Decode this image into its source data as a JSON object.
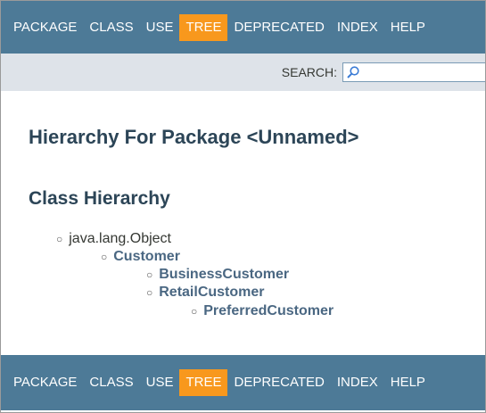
{
  "nav_top": {
    "items": [
      {
        "label": "PACKAGE",
        "active": false
      },
      {
        "label": "CLASS",
        "active": false
      },
      {
        "label": "USE",
        "active": false
      },
      {
        "label": "TREE",
        "active": true
      },
      {
        "label": "DEPRECATED",
        "active": false
      },
      {
        "label": "INDEX",
        "active": false
      },
      {
        "label": "HELP",
        "active": false
      }
    ]
  },
  "search": {
    "label": "SEARCH:",
    "value": "",
    "icon": "search-icon"
  },
  "page": {
    "title": "Hierarchy For Package <Unnamed>",
    "section_title": "Class Hierarchy"
  },
  "tree": [
    {
      "label": "java.lang.Object",
      "link": false
    },
    {
      "label": "Customer",
      "link": true
    },
    {
      "label": "BusinessCustomer",
      "link": true
    },
    {
      "label": "RetailCustomer",
      "link": true
    },
    {
      "label": "PreferredCustomer",
      "link": true
    }
  ],
  "nav_bottom": {
    "items": [
      {
        "label": "PACKAGE",
        "active": false
      },
      {
        "label": "CLASS",
        "active": false
      },
      {
        "label": "USE",
        "active": false
      },
      {
        "label": "TREE",
        "active": true
      },
      {
        "label": "DEPRECATED",
        "active": false
      },
      {
        "label": "INDEX",
        "active": false
      },
      {
        "label": "HELP",
        "active": false
      }
    ]
  },
  "colors": {
    "navbar_bg": "#4d7a97",
    "active_tab": "#f8981d",
    "subnav_bg": "#dee3e9",
    "link": "#4a6782",
    "heading": "#2c4557"
  }
}
